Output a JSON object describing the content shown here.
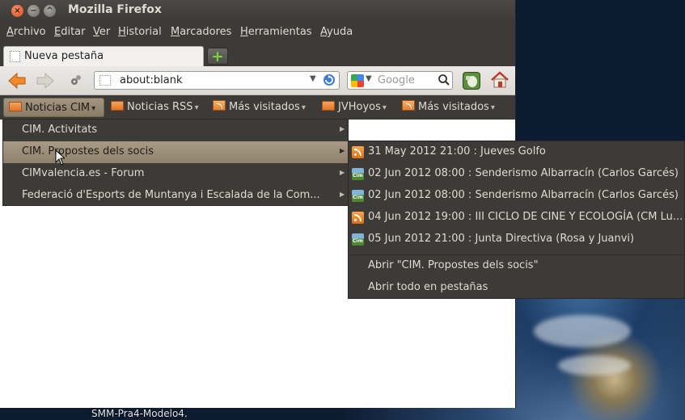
{
  "window": {
    "title": "Mozilla Firefox",
    "controls": {
      "close": "×",
      "minimize": "−",
      "maximize": "^"
    }
  },
  "menubar": [
    "Archivo",
    "Editar",
    "Ver",
    "Historial",
    "Marcadores",
    "Herramientas",
    "Ayuda"
  ],
  "tabs": [
    {
      "label": "Nueva pestaña"
    }
  ],
  "newtab_symbol": "+",
  "navbar": {
    "url": "about:blank",
    "search_placeholder": "Google",
    "dropdown_glyph": "▼"
  },
  "bookmarks": [
    {
      "label": "Noticias CIM",
      "icon": "folder-icon",
      "active": true
    },
    {
      "label": "Noticias RSS",
      "icon": "folder-icon"
    },
    {
      "label": "Más visitados",
      "icon": "folder-rss-icon"
    },
    {
      "label": "JVHoyos",
      "icon": "folder-icon"
    },
    {
      "label": "Más visitados",
      "icon": "folder-rss-icon"
    }
  ],
  "bookmark_arrow": "▾",
  "submenu_arrow": "▶",
  "menu_noticias_cim": [
    {
      "label": "CIM. Activitats"
    },
    {
      "label": "CIM. Propostes dels socis",
      "highlighted": true
    },
    {
      "label": "CIMvalencia.es - Forum"
    },
    {
      "label": "Federació d'Esports de Muntanya i Escalada de la Com..."
    }
  ],
  "menu_propostes": {
    "items": [
      {
        "label": "31 May 2012 21:00 : Jueves Golfo",
        "icon": "rss-feed-icon"
      },
      {
        "label": "02 Jun 2012 08:00 : Senderismo Albarracín (Carlos Garcés)",
        "icon": "cim-logo-icon"
      },
      {
        "label": "02 Jun 2012 08:00 : Senderismo Albarracín (Carlos Garcés)",
        "icon": "cim-logo-icon"
      },
      {
        "label": "04 Jun 2012 19:00 : III CICLO DE CINE Y ECOLOGÍA (CM Lu...",
        "icon": "rss-feed-icon"
      },
      {
        "label": "05 Jun 2012 21:00 : Junta Directiva (Rosa y Juanvi)",
        "icon": "cim-logo-icon"
      }
    ],
    "open_folder": "Abrir \"CIM. Propostes dels socis\"",
    "open_all_tabs": "Abrir todo en pestañas"
  },
  "desktop_label": "SMM-Pra4-Modelo4."
}
